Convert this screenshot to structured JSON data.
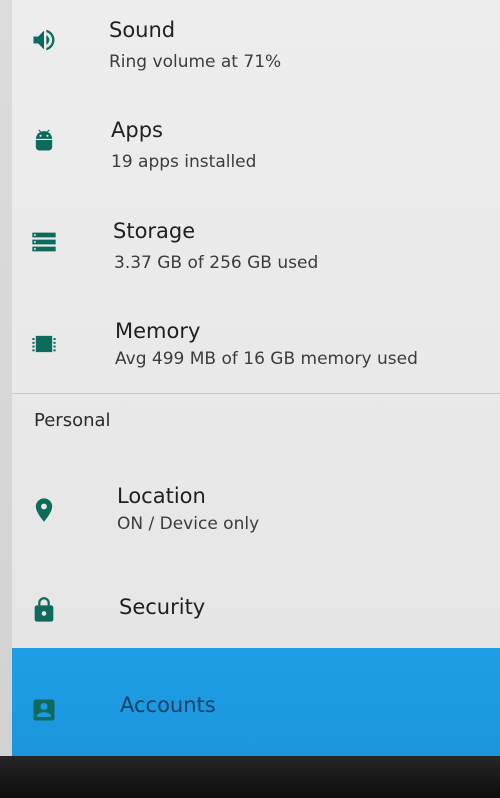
{
  "device": {
    "items": [
      {
        "title": "Sound",
        "summary": "Ring volume at 71%",
        "icon": "volume-icon"
      },
      {
        "title": "Apps",
        "summary": "19 apps installed",
        "icon": "android-icon"
      },
      {
        "title": "Storage",
        "summary": "3.37 GB of 256 GB used",
        "icon": "storage-icon"
      },
      {
        "title": "Memory",
        "summary": "Avg 499 MB of 16 GB memory used",
        "icon": "memory-chip-icon"
      }
    ]
  },
  "personal": {
    "header": "Personal",
    "items": [
      {
        "title": "Location",
        "summary": "ON / Device only",
        "icon": "location-pin-icon"
      },
      {
        "title": "Security",
        "icon": "lock-icon"
      },
      {
        "title": "Accounts",
        "icon": "account-icon",
        "selected": true
      }
    ]
  },
  "colors": {
    "icon": "#0e6b5c",
    "selected_row": "#1e9ee6",
    "selected_text": "#0c3f66"
  }
}
